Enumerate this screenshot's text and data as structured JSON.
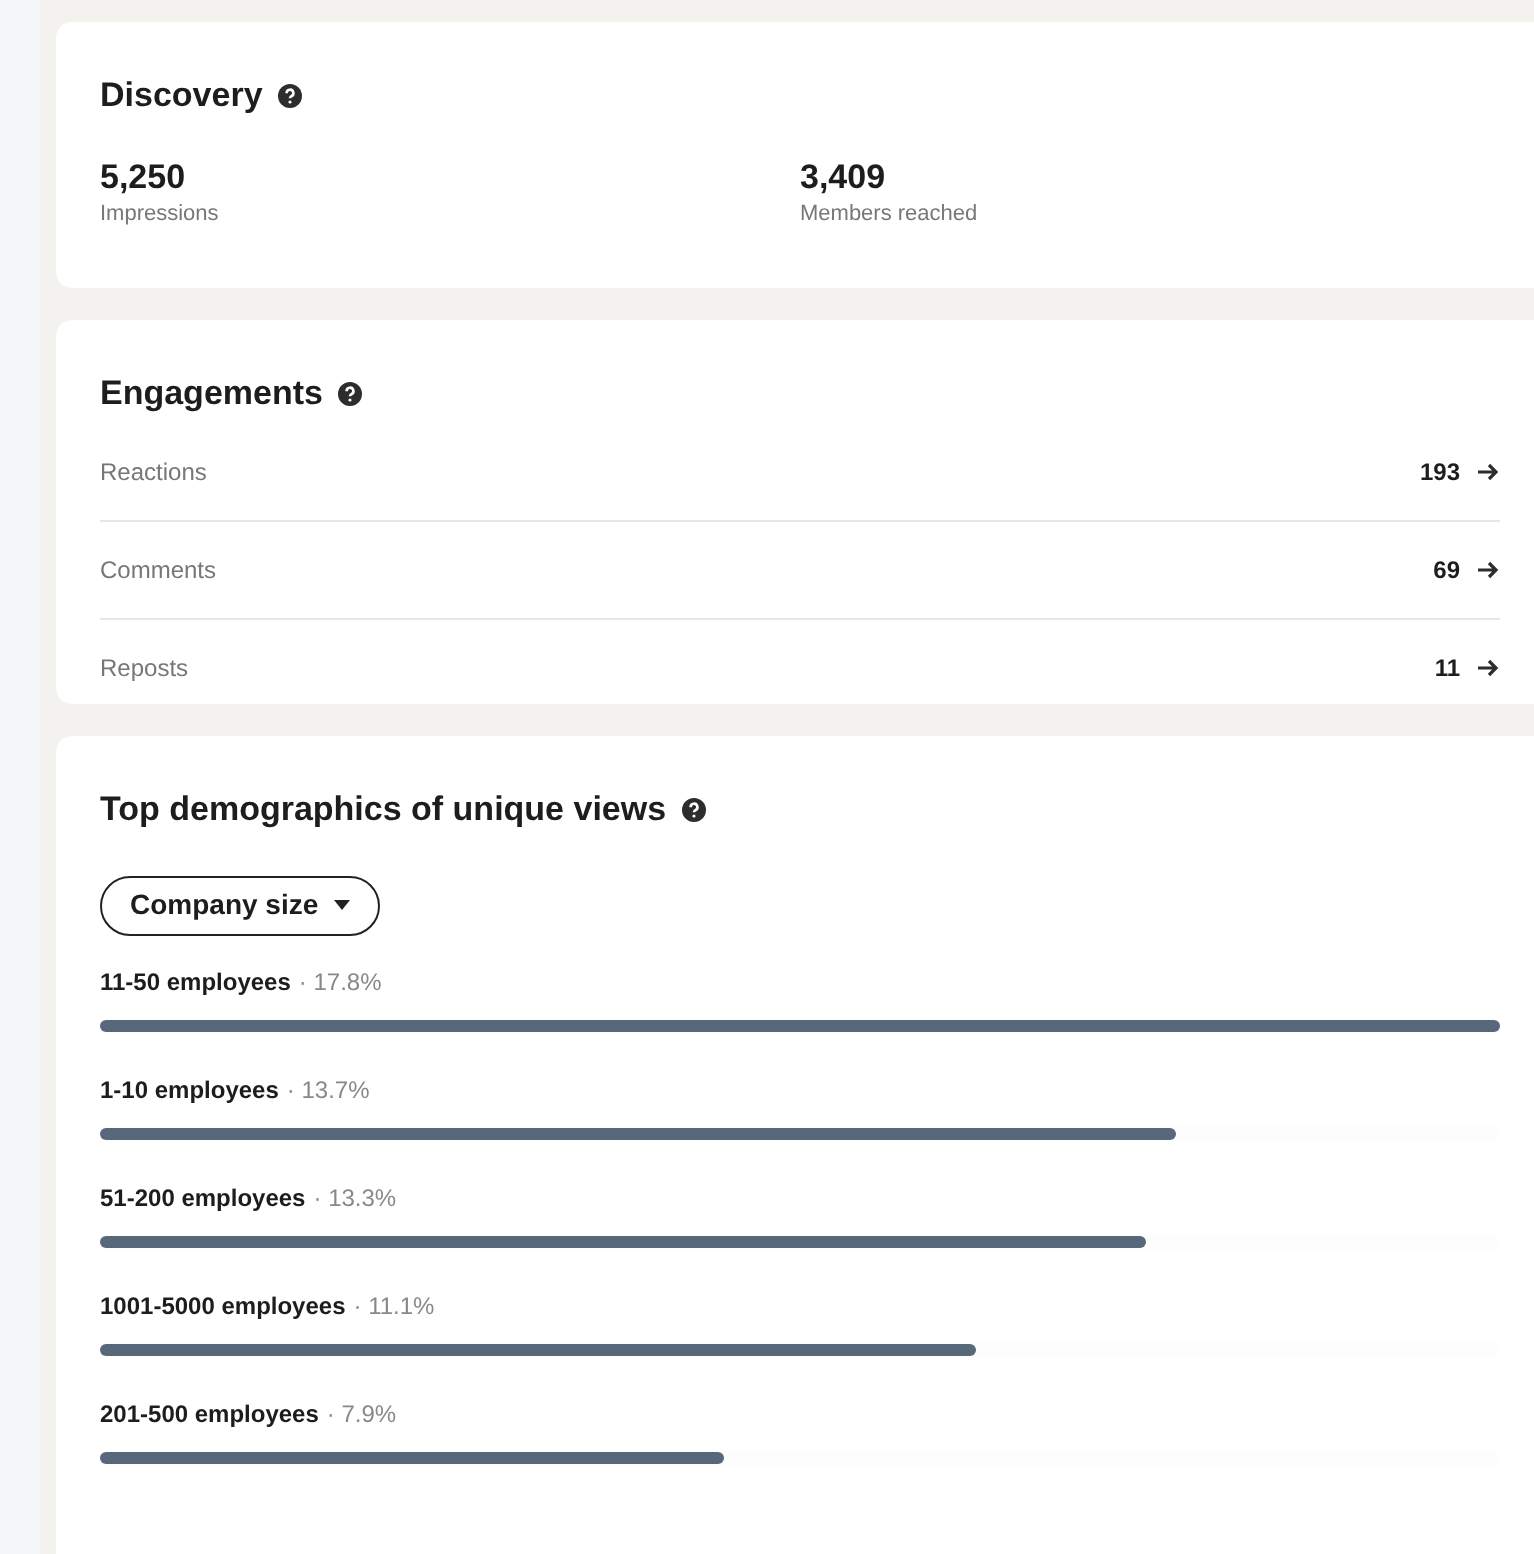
{
  "discovery": {
    "title": "Discovery",
    "stats": [
      {
        "value": "5,250",
        "label": "Impressions"
      },
      {
        "value": "3,409",
        "label": "Members reached"
      }
    ]
  },
  "engagements": {
    "title": "Engagements",
    "rows": [
      {
        "label": "Reactions",
        "value": "193"
      },
      {
        "label": "Comments",
        "value": "69"
      },
      {
        "label": "Reposts",
        "value": "11"
      }
    ]
  },
  "demographics": {
    "title": "Top demographics of unique views",
    "filter": "Company size",
    "items": [
      {
        "label": "11-50 employees",
        "percent": "· 17.8%",
        "level": 1.0
      },
      {
        "label": "1-10 employees",
        "percent": "· 13.7%",
        "level": 0.769
      },
      {
        "label": "51-200 employees",
        "percent": "· 13.3%",
        "level": 0.747
      },
      {
        "label": "1001-5000 employees",
        "percent": "· 11.1%",
        "level": 0.626
      },
      {
        "label": "201-500 employees",
        "percent": "· 7.9%",
        "level": 0.446
      }
    ]
  }
}
